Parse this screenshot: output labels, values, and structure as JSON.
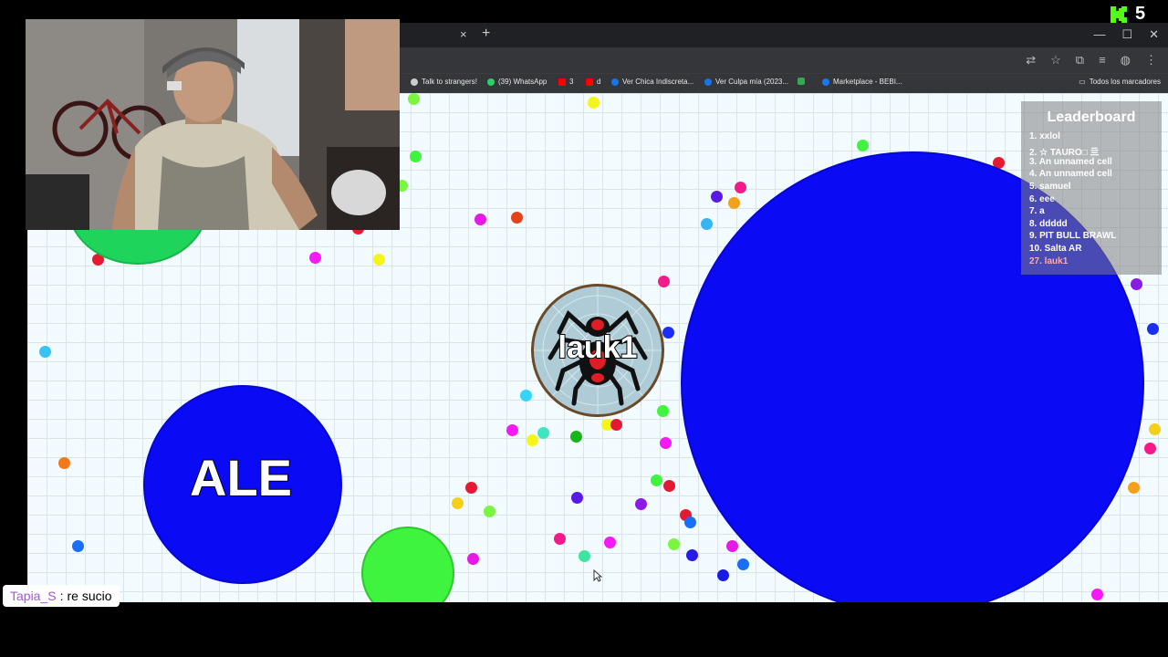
{
  "browser": {
    "tab_close": "×",
    "tab_new": "+",
    "window_controls": [
      "—",
      "☐",
      "✕"
    ],
    "toolbar_icons": [
      "translate-icon",
      "star-icon",
      "extensions-icon",
      "media-icon",
      "profile-icon",
      "menu-icon"
    ],
    "bookmarks": [
      {
        "label": "Talk to strangers!",
        "icon_color": "#cccccc"
      },
      {
        "label": "(39) WhatsApp",
        "icon_color": "#25d366"
      },
      {
        "label": "3",
        "icon_color": "#ff0000"
      },
      {
        "label": "d",
        "icon_color": "#ff0000"
      },
      {
        "label": "Ver Chica Indiscreta...",
        "icon_color": "#1a73e8"
      },
      {
        "label": "Ver Culpa mía (2023...",
        "icon_color": "#1a73e8"
      },
      {
        "label": "",
        "icon_color": "#34a853"
      },
      {
        "label": "Marketplace - BEBI...",
        "icon_color": "#1877f2"
      }
    ],
    "bookmarks_all": "Todos los marcadores"
  },
  "game": {
    "cells": [
      {
        "name": "lauk1",
        "color": "#aecbd6",
        "skin": "spider"
      },
      {
        "name": "ALE",
        "color": "#0a0af5"
      },
      {
        "name": "",
        "color": "#0a0af5"
      },
      {
        "name": "",
        "color": "#3ef43e"
      },
      {
        "name": "",
        "color": "#1fd45b"
      }
    ]
  },
  "leaderboard": {
    "title": "Leaderboard",
    "entries": [
      "1. xxlol",
      "2. ☆ TAURO□ 亖",
      "3. An unnamed cell",
      "4. An unnamed cell",
      "5. samuel",
      "6. eee",
      "7. a",
      "8. ddddd",
      "9. PIT BULL BRAWL",
      "10. Salta AR"
    ],
    "self_entry": "27. lauk1",
    "self_color": "#ffaaaa"
  },
  "stream": {
    "kick_viewers": "5",
    "chat": {
      "user": "Tapia_S",
      "separator": ":",
      "message": "re sucio"
    }
  }
}
